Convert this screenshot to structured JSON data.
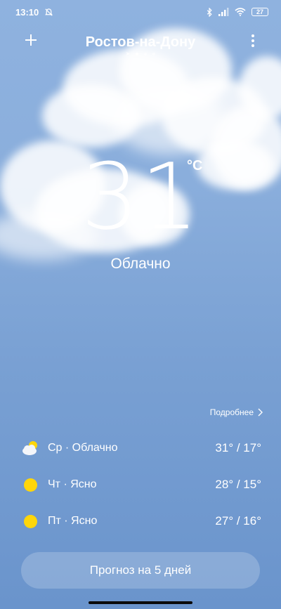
{
  "status_bar": {
    "time": "13:10",
    "battery": "27",
    "icons": [
      "bell-off-icon",
      "bluetooth-icon",
      "signal-icon",
      "wifi-icon",
      "battery-icon"
    ]
  },
  "header": {
    "city": "Ростов-на-Дону",
    "add_icon": "plus-icon",
    "menu_icon": "more-vert-icon"
  },
  "current": {
    "temperature": "31",
    "unit": "°C",
    "condition": "Облачно"
  },
  "more_link": "Подробнее",
  "forecast": [
    {
      "day": "Ср · Облачно",
      "temps": "31° / 17°",
      "icon": "cloudy-sun-icon"
    },
    {
      "day": "Чт · Ясно",
      "temps": "28° / 15°",
      "icon": "sun-icon"
    },
    {
      "day": "Пт · Ясно",
      "temps": "27° / 16°",
      "icon": "sun-icon"
    }
  ],
  "forecast_button": "Прогноз на 5 дней",
  "colors": {
    "sun": "#ffd60a",
    "sky_top": "#8fb2df",
    "sky_bottom": "#6a94cc"
  }
}
